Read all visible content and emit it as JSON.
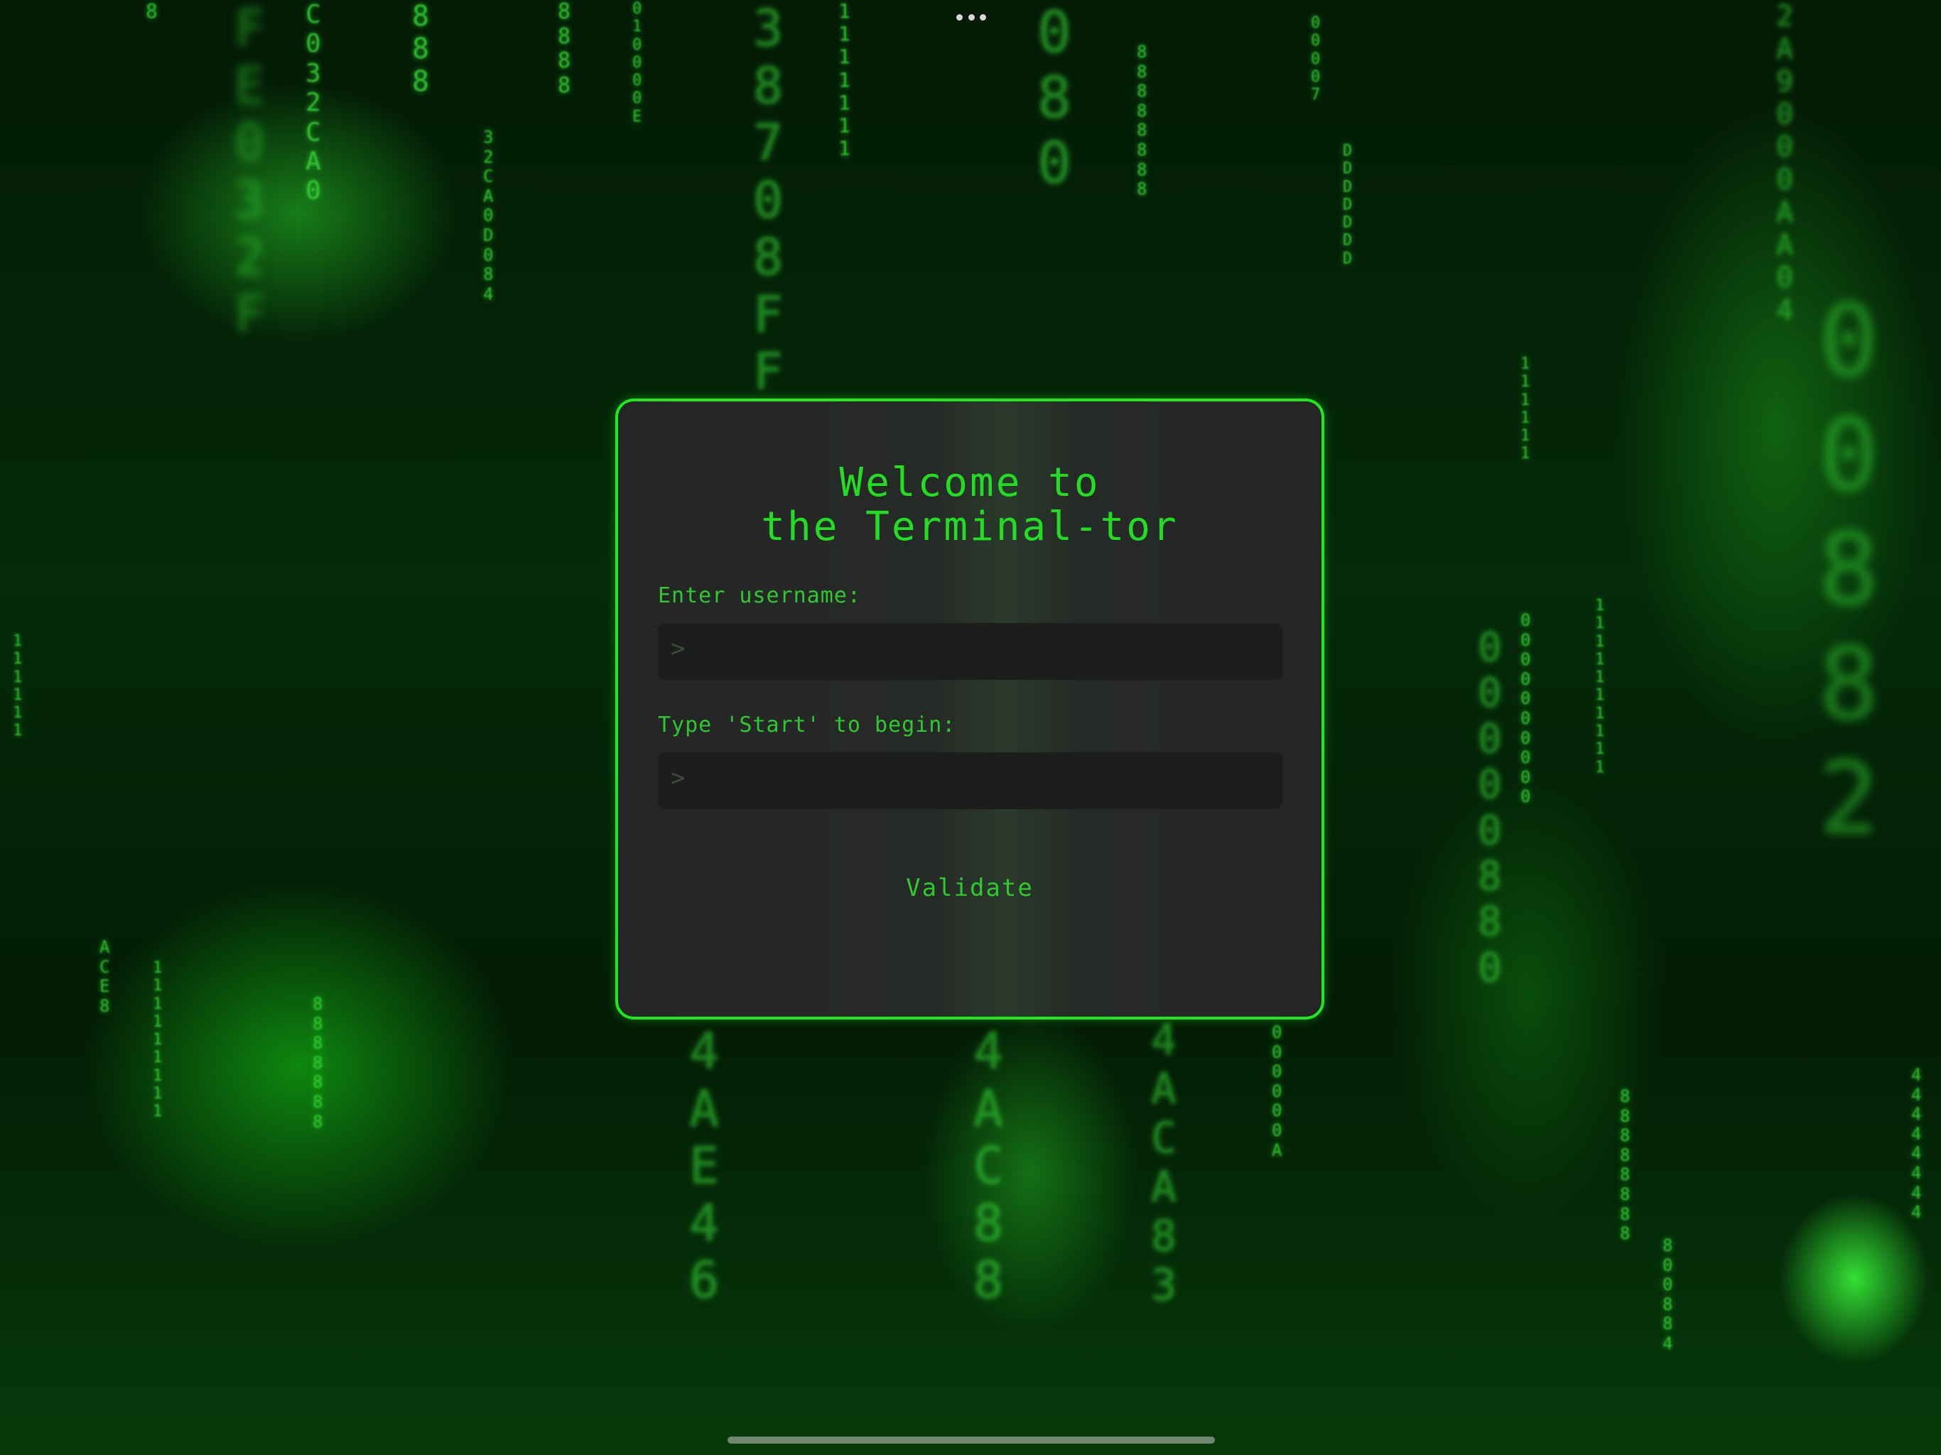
{
  "login_card": {
    "title_line1": "Welcome to",
    "title_line2": "the Terminal-tor",
    "username_label": "Enter username:",
    "username_prompt": ">",
    "username_value": "",
    "start_label": "Type 'Start' to begin:",
    "start_prompt": ">",
    "start_value": "",
    "validate_label": "Validate"
  },
  "colors": {
    "accent": "#1fe81f",
    "text_green": "#2fc82f",
    "card_bg": "#262826",
    "field_bg": "#1c1e1c"
  },
  "icons": {
    "menu": "more-dots-icon",
    "home": "home-indicator"
  }
}
